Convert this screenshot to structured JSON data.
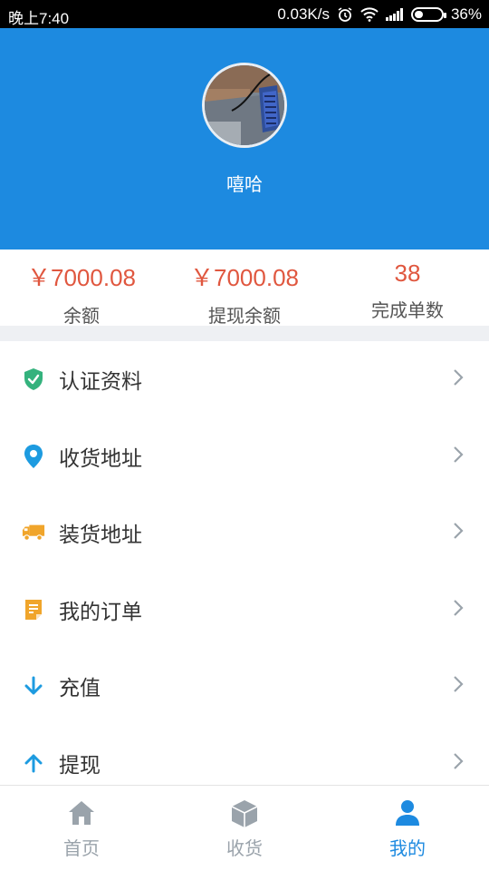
{
  "status_bar": {
    "time": "晚上7:40",
    "network_speed": "0.03K/s",
    "battery": "36%"
  },
  "profile": {
    "username": "嘻哈"
  },
  "stats": [
    {
      "value": "￥7000.08",
      "label": "余额"
    },
    {
      "value": "￥7000.08",
      "label": "提现余额"
    },
    {
      "value": "38",
      "label": "完成单数"
    }
  ],
  "menu": [
    {
      "label": "认证资料",
      "icon": "shield-check-icon",
      "color": "#34b27d"
    },
    {
      "label": "收货地址",
      "icon": "location-pin-icon",
      "color": "#1d9be0"
    },
    {
      "label": "装货地址",
      "icon": "truck-icon",
      "color": "#f0a52b"
    },
    {
      "label": "我的订单",
      "icon": "order-document-icon",
      "color": "#f0a52b"
    },
    {
      "label": "充值",
      "icon": "arrow-down-icon",
      "color": "#1d9be0"
    },
    {
      "label": "提现",
      "icon": "arrow-up-icon",
      "color": "#1d9be0"
    }
  ],
  "tabbar": {
    "tabs": [
      {
        "label": "首页",
        "icon": "home-icon"
      },
      {
        "label": "收货",
        "icon": "box-icon"
      },
      {
        "label": "我的",
        "icon": "user-icon",
        "active": true
      }
    ]
  },
  "colors": {
    "accent": "#1d8ae0",
    "stat_value": "#e0573f"
  }
}
